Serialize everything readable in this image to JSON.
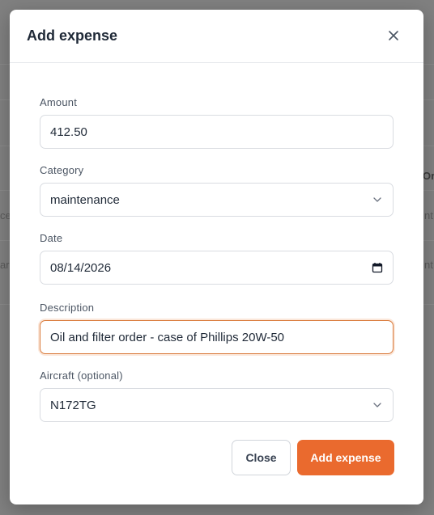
{
  "background": {
    "fragments": [
      "ce",
      "ar",
      "Ori",
      "nt",
      "nt"
    ]
  },
  "modal": {
    "title": "Add expense",
    "fields": {
      "amount": {
        "label": "Amount",
        "value": "412.50"
      },
      "category": {
        "label": "Category",
        "value": "maintenance"
      },
      "date": {
        "label": "Date",
        "value": "08/14/2026"
      },
      "description": {
        "label": "Description",
        "value": "Oil and filter order - case of Phillips 20W-50"
      },
      "aircraft": {
        "label": "Aircraft (optional)",
        "value": "N172TG"
      }
    },
    "buttons": {
      "close": "Close",
      "add": "Add expense"
    }
  },
  "colors": {
    "accent": "#ea6a2e",
    "focus_border": "#d97a3a",
    "overlay": "#808080"
  },
  "icons": [
    "close-icon",
    "chevron-down-icon",
    "calendar-icon"
  ]
}
